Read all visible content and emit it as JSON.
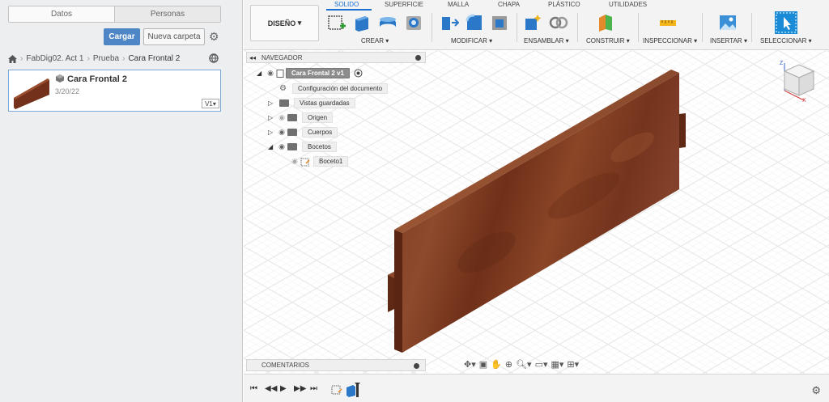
{
  "data_panel": {
    "tabs": [
      "Datos",
      "Personas"
    ],
    "upload_label": "Cargar",
    "new_folder_label": "Nueva carpeta",
    "breadcrumb": [
      "FabDig02. Act 1",
      "Prueba",
      "Cara Frontal 2"
    ],
    "file": {
      "name": "Cara Frontal 2",
      "date": "3/20/22",
      "version": "V1"
    }
  },
  "toolbar": {
    "workspace": "DISEÑO",
    "tabs": [
      "SOLIDO",
      "SUPERFICIE",
      "MALLA",
      "CHAPA",
      "PLÁSTICO",
      "UTILIDADES"
    ],
    "active_tab": "SOLIDO",
    "groups": [
      "CREAR",
      "MODIFICAR",
      "ENSAMBLAR",
      "CONSTRUIR",
      "INSPECCIONAR",
      "INSERTAR",
      "SELECCIONAR"
    ],
    "accent_color": "#1a6fd2"
  },
  "browser": {
    "title": "NAVEGADOR",
    "root": "Cara Frontal 2 v1",
    "items": [
      "Configuración del documento",
      "Vistas guardadas",
      "Origen",
      "Cuerpos",
      "Bocetos",
      "Boceto1"
    ]
  },
  "comments": {
    "title": "COMENTARIOS"
  },
  "viewcube": {
    "axes": [
      "Z",
      "X"
    ]
  },
  "model": {
    "material_color": "#7a3520"
  }
}
